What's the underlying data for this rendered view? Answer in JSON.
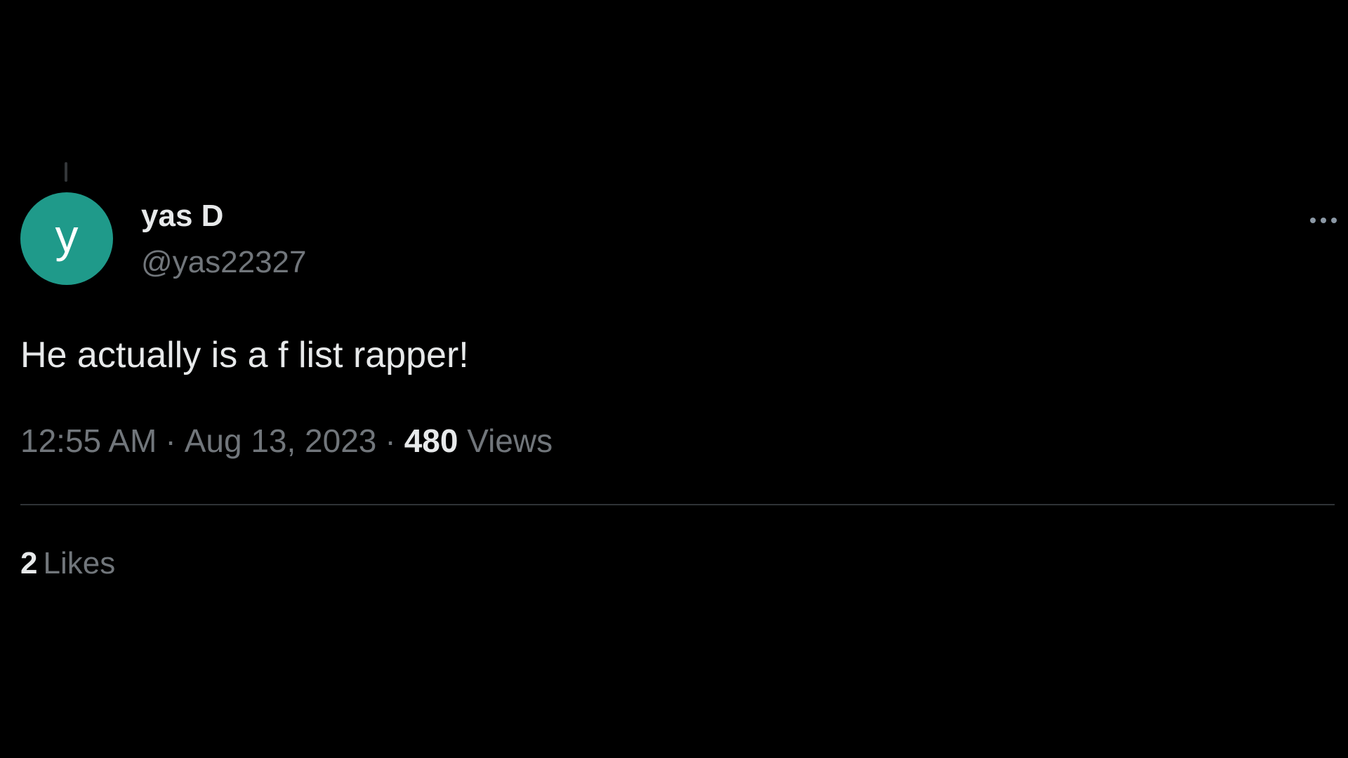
{
  "tweet": {
    "avatar_letter": "y",
    "avatar_color": "#1f9a8a",
    "display_name": "yas D",
    "handle": "@yas22327",
    "more_icon": "more-horizontal-icon",
    "text": "He actually is a f list rapper!",
    "time": "12:55 AM",
    "separator": "·",
    "date": "Aug 13, 2023",
    "views_count": "480",
    "views_label": "Views",
    "likes_count": "2",
    "likes_label": "Likes"
  },
  "colors": {
    "background": "#000000",
    "primary_text": "#e7e9ea",
    "secondary_text": "#71767b",
    "divider": "#2f3336"
  }
}
